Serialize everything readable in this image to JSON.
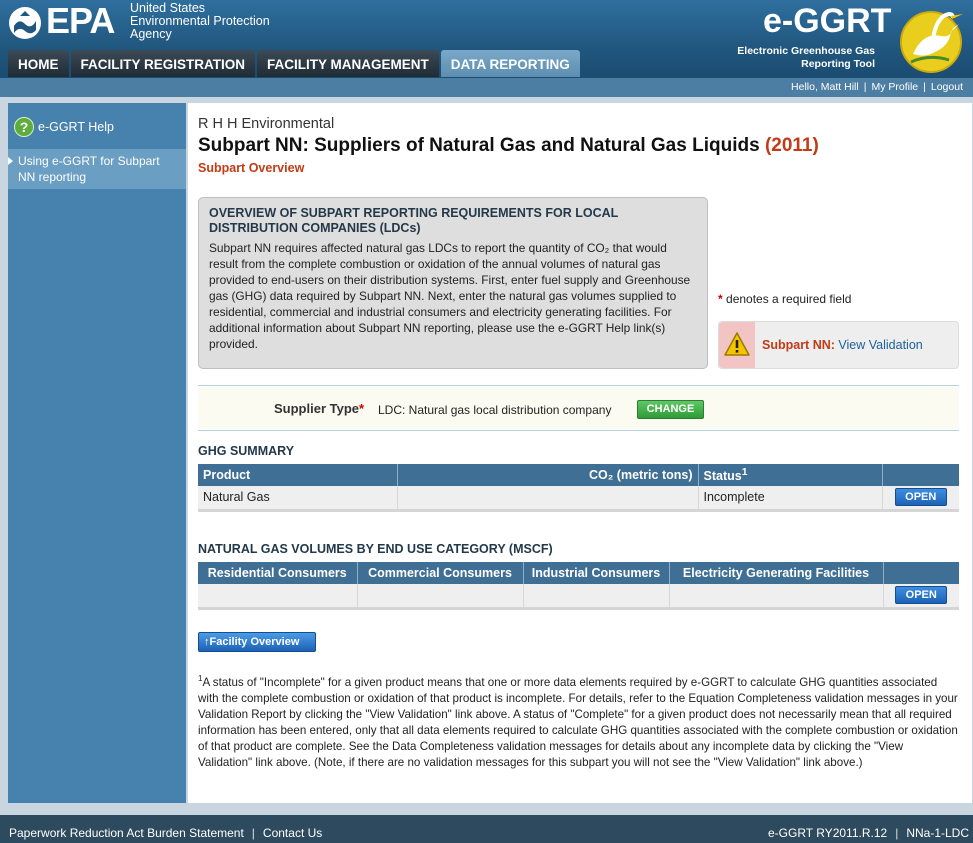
{
  "header": {
    "epa_word": "EPA",
    "agency_line1": "United States",
    "agency_line2": "Environmental Protection",
    "agency_line3": "Agency",
    "app_name": "e-GGRT",
    "app_sub1": "Electronic Greenhouse Gas",
    "app_sub2": "Reporting Tool"
  },
  "nav": {
    "tabs": [
      {
        "label": "HOME",
        "active": false
      },
      {
        "label": "FACILITY REGISTRATION",
        "active": false
      },
      {
        "label": "FACILITY MANAGEMENT",
        "active": false
      },
      {
        "label": "DATA REPORTING",
        "active": true
      }
    ]
  },
  "userbar": {
    "greeting": "Hello, Matt Hill",
    "my_profile": "My Profile",
    "logout": "Logout"
  },
  "sidebar": {
    "help_label": "e-GGRT Help",
    "item_label": "Using e-GGRT for Subpart NN reporting"
  },
  "page": {
    "company": "R H H Environmental",
    "title": "Subpart NN: Suppliers of Natural Gas and Natural Gas Liquids",
    "year": "(2011)",
    "subtitle": "Subpart Overview"
  },
  "overview": {
    "heading": "OVERVIEW OF SUBPART REPORTING REQUIREMENTS FOR LOCAL DISTRIBUTION COMPANIES (LDCs)",
    "body": "Subpart NN requires affected natural gas LDCs to report the quantity of CO₂ that would result from the complete combustion or oxidation of the annual volumes of natural gas provided to end-users on their distribution systems. First, enter fuel supply and Greenhouse gas (GHG) data required by Subpart NN. Next, enter the natural gas volumes supplied to residential, commercial and industrial consumers and electricity generating facilities. For additional information about Subpart NN reporting, please use the e-GGRT Help link(s) provided."
  },
  "required": {
    "star": "*",
    "text": "denotes a required field"
  },
  "validation": {
    "label": "Subpart NN:",
    "link": "View Validation"
  },
  "supplier": {
    "label": "Supplier Type",
    "star": "*",
    "value": "LDC: Natural gas local distribution company",
    "change": "CHANGE"
  },
  "ghg_summary": {
    "title": "GHG SUMMARY",
    "headers": [
      "Product",
      "CO₂ (metric tons)",
      "Status",
      ""
    ],
    "status_sup": "1",
    "row": {
      "product": "Natural Gas",
      "co2": "",
      "status": "Incomplete",
      "action": "OPEN"
    }
  },
  "volumes": {
    "title": "NATURAL GAS VOLUMES BY END USE CATEGORY (MSCF)",
    "headers": [
      "Residential Consumers",
      "Commercial Consumers",
      "Industrial Consumers",
      "Electricity Generating Facilities",
      ""
    ],
    "row": {
      "residential": "",
      "commercial": "",
      "industrial": "",
      "electricity": "",
      "action": "OPEN"
    }
  },
  "facility_button": "Facility Overview",
  "footnote": {
    "sup": "1",
    "text": "A status of \"Incomplete\" for a given product means that one or more data elements required by e-GGRT to calculate GHG quantities associated with the complete combustion or oxidation of that product is incomplete. For details, refer to the Equation Completeness validation messages in your Validation Report by clicking the \"View Validation\" link above. A status of \"Complete\" for a given product does not necessarily mean that all required information has been entered, only that all data elements required to calculate GHG quantities associated with the complete combustion or oxidation of that product are complete. See the Data Completeness validation messages for details about any incomplete data by clicking the \"View Validation\" link above. (Note, if there are no validation messages for this subpart you will not see the \"View Validation\" link above.)"
  },
  "footer": {
    "paperwork": "Paperwork Reduction Act Burden Statement",
    "contact": "Contact Us",
    "version": "e-GGRT RY2011.R.12",
    "page_id": "NNa-1-LDC"
  }
}
